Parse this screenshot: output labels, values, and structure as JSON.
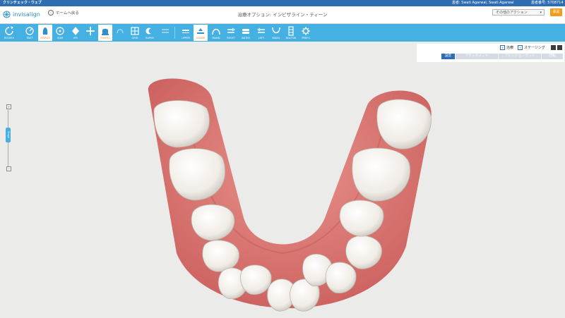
{
  "topbar": {
    "app": "クリンチェック・ウェブ",
    "doctor": "患者: Swati Agarwal, Swati Agarwal",
    "patient": "患者番号: 5708714"
  },
  "header": {
    "logo": "invisalign",
    "home": "ホームへ戻る",
    "title": "治療オプション: インビザライン・ティーン",
    "action_select": "その他のアクション",
    "order_button": "承認"
  },
  "toolbar": {
    "buttons": [
      {
        "name": "rotate",
        "label": "ROTATE",
        "icon": "rotate-icon"
      },
      {
        "name": "past",
        "label": "PAST",
        "icon": "gauge-icon"
      },
      {
        "name": "attach",
        "label": "ATTACH",
        "icon": "attach-icon",
        "active": true
      },
      {
        "name": "sqm",
        "label": "SQM",
        "icon": "sqm-icon"
      },
      {
        "name": "ipr",
        "label": "IPR",
        "icon": "diamond-icon"
      },
      {
        "name": "move",
        "label": "",
        "icon": "move-icon"
      },
      {
        "name": "pontic",
        "label": "PONTIC",
        "icon": "pontic-icon",
        "active": true
      },
      {
        "name": "mesial",
        "label": "",
        "icon": "mesial-icon",
        "dim": true
      },
      {
        "name": "grid",
        "label": "GRID",
        "icon": "grid-icon"
      },
      {
        "name": "super",
        "label": "SUPER",
        "icon": "super-icon"
      },
      {
        "name": "diff",
        "label": "",
        "icon": "diff-icon",
        "dim": true
      },
      {
        "name": "upper",
        "label": "UPPER",
        "icon": "upper-icon"
      },
      {
        "name": "lower",
        "label": "LOWER",
        "icon": "lower-icon",
        "active": true
      },
      {
        "name": "mand",
        "label": "MAND",
        "icon": "mand-icon"
      },
      {
        "name": "right",
        "label": "RIGHT",
        "icon": "right-icon"
      },
      {
        "name": "anter",
        "label": "ANTER",
        "icon": "anter-icon"
      },
      {
        "name": "left",
        "label": "LEFT",
        "icon": "left-icon"
      },
      {
        "name": "maxil",
        "label": "MAXIL",
        "icon": "maxil-icon"
      },
      {
        "name": "bolton",
        "label": "BOLTON",
        "icon": "bolton-icon"
      },
      {
        "name": "prefs",
        "label": "PREFS",
        "icon": "gear-icon"
      }
    ]
  },
  "panel": {
    "treatment_toggle": "治療",
    "staging_toggle": "ステージング",
    "tabs": [
      {
        "label": "設定",
        "active": true
      },
      {
        "label": "アタッチメント",
        "active": false
      },
      {
        "label": "プレシジョンカット",
        "active": false
      },
      {
        "label": "回転",
        "active": false
      }
    ]
  },
  "slider": {
    "label": "Stage",
    "plus": "+",
    "minus": "−"
  },
  "colors": {
    "toolbar": "#45b0e2",
    "topbar": "#2f6db3",
    "gum": "#d8726e",
    "tooth": "#f2efe9",
    "accent": "#f29c1f"
  }
}
